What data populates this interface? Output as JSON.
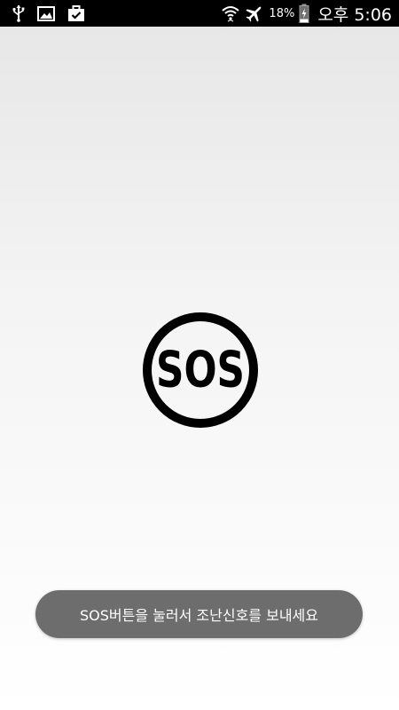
{
  "status_bar": {
    "battery_percent": "18%",
    "time": "오후 5:06",
    "icons": [
      "usb-icon",
      "image-icon",
      "briefcase-check-icon",
      "wifi-icon",
      "airplane-mode-icon",
      "battery-charging-icon"
    ]
  },
  "main": {
    "sos_button_label": "SOS"
  },
  "toast": {
    "message": "SOS버튼을 눌러서 조난신호를 보내세요"
  },
  "colors": {
    "status_bar_bg": "#000000",
    "toast_bg": "#6d6d6d",
    "sos_icon": "#000000"
  }
}
